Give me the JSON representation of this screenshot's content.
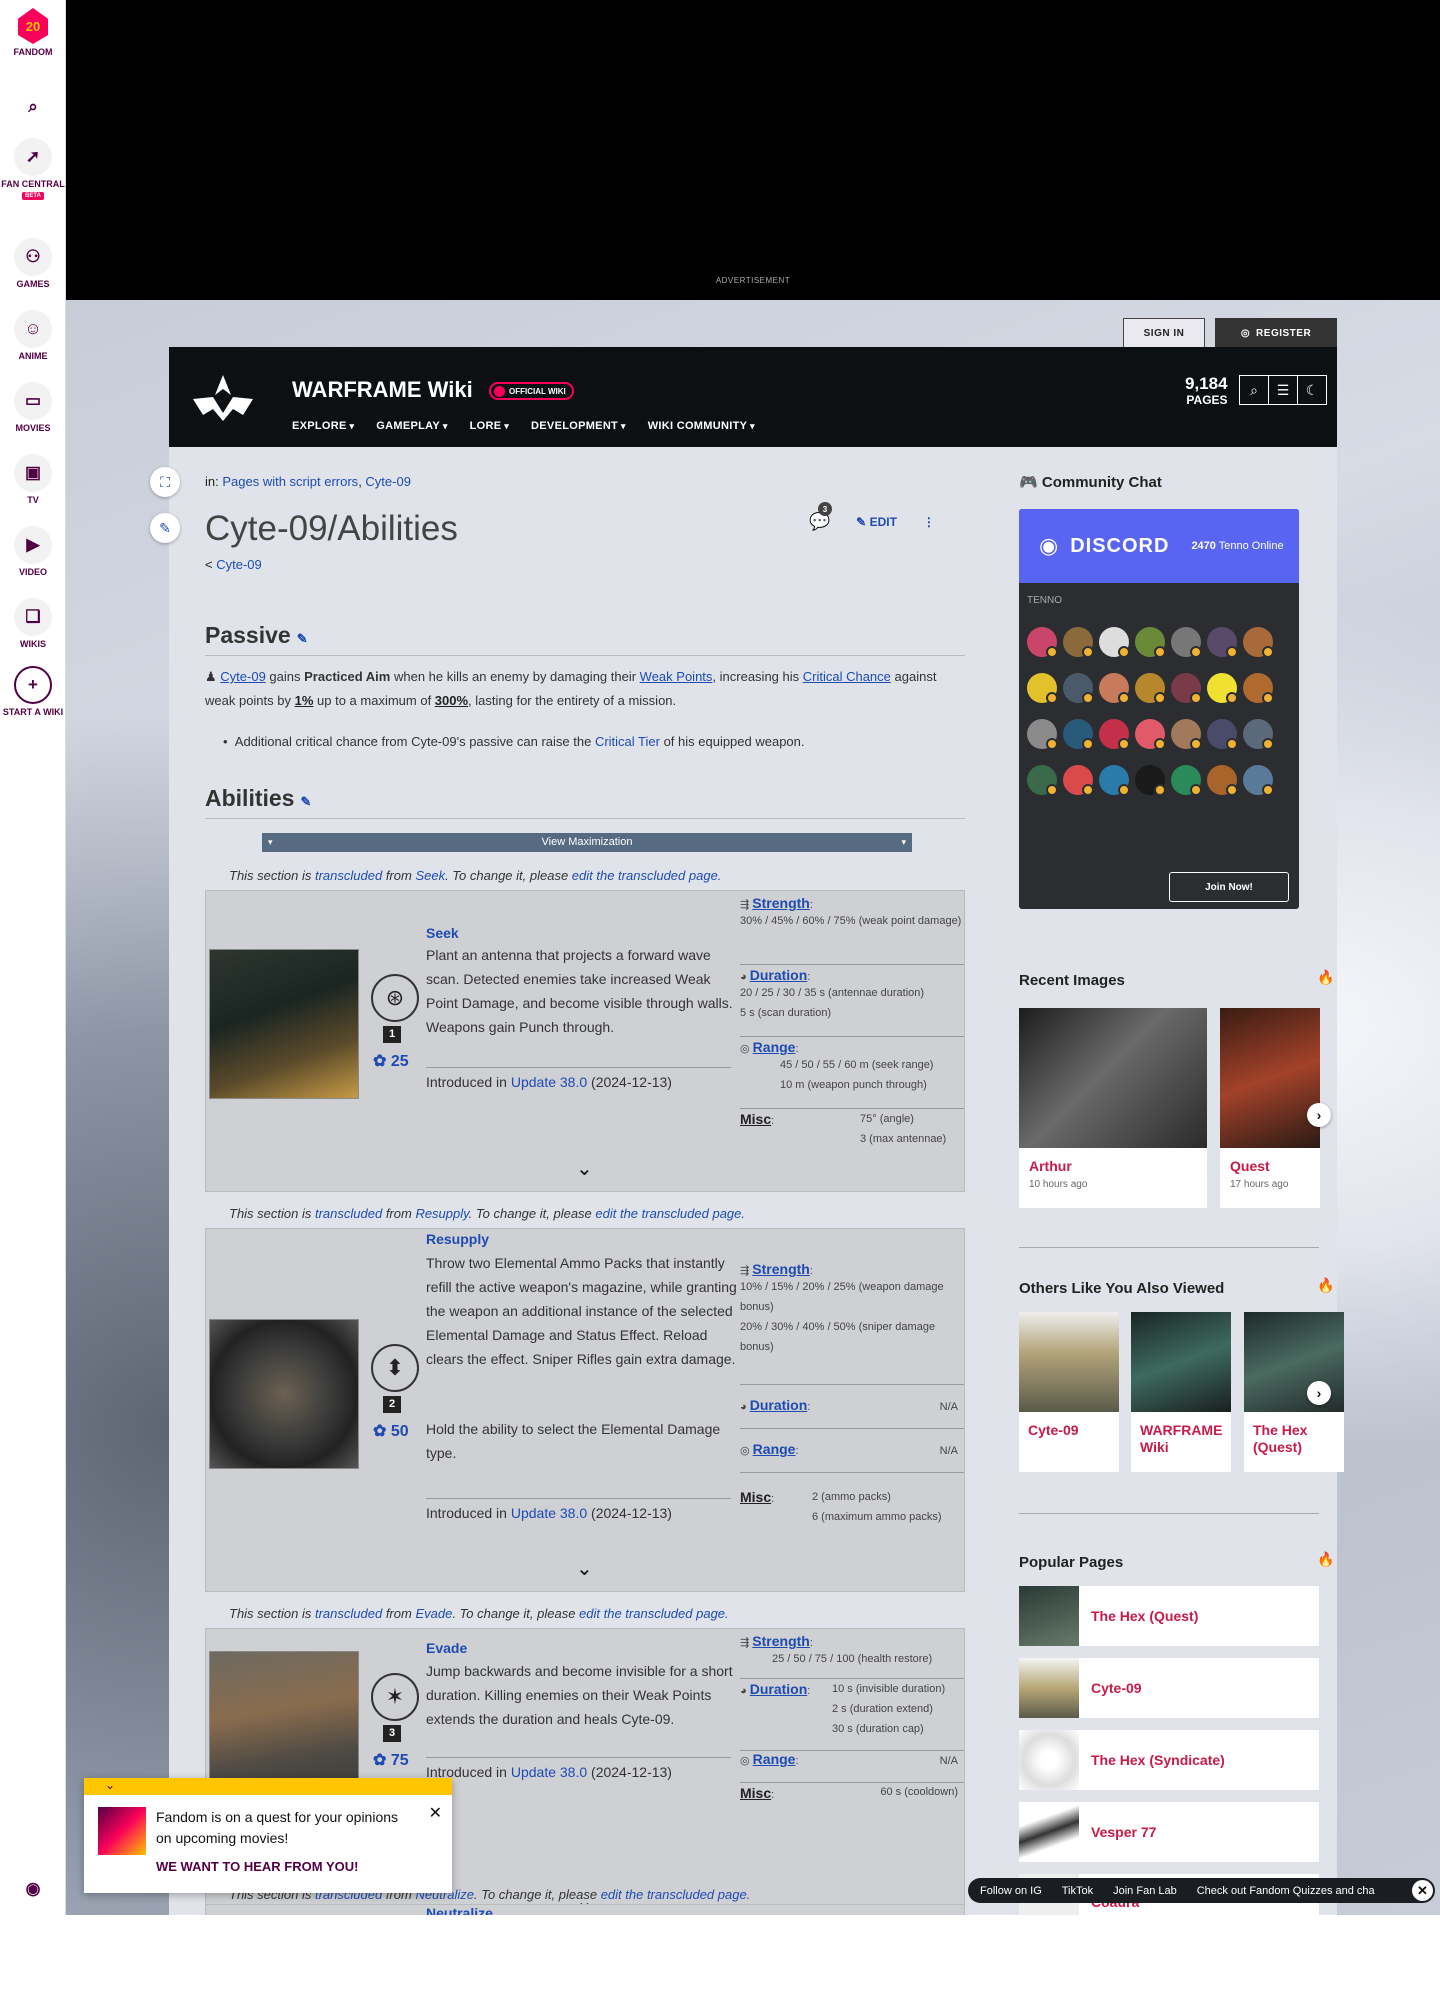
{
  "rail": {
    "fandom": "FANDOM",
    "fandom_badge": "20",
    "fan_central": "FAN CENTRAL",
    "beta": "BETA",
    "games": "GAMES",
    "anime": "ANIME",
    "movies": "MOVIES",
    "tv": "TV",
    "video": "VIDEO",
    "wikis": "WIKIS",
    "start_wiki": "START A WIKI"
  },
  "ad": {
    "label": "ADVERTISEMENT"
  },
  "auth": {
    "sign_in": "SIGN IN",
    "register": "REGISTER"
  },
  "header": {
    "title": "WARFRAME Wiki",
    "badge": "OFFICIAL WIKI",
    "pages_count": "9,184",
    "pages_label": "PAGES",
    "nav": [
      "EXPLORE",
      "GAMEPLAY",
      "LORE",
      "DEVELOPMENT",
      "WIKI COMMUNITY"
    ]
  },
  "page": {
    "in_label": "in:",
    "cat1": "Pages with script errors",
    "cat2": "Cyte-09",
    "title": "Cyte-09/Abilities",
    "parent": "Cyte-09",
    "comment_count": "3",
    "edit": "EDIT"
  },
  "passive": {
    "heading": "Passive",
    "p1": "Cyte-09",
    "p2": " gains ",
    "p3": "Practiced Aim",
    "p4": " when he kills an enemy by damaging their ",
    "p5": "Weak Points",
    "p6": ", increasing his ",
    "p7": "Critical Chance",
    "p8": " against weak points by ",
    "p9": "1%",
    "p10": " up to a maximum of ",
    "p11": "300%",
    "p12": ", lasting for the entirety of a mission.",
    "bullet_a": "Additional critical chance from Cyte-09's passive can raise the ",
    "bullet_b": "Critical Tier",
    "bullet_c": " of his equipped weapon."
  },
  "abilities_heading": "Abilities",
  "view_max": "View Maximization",
  "trans": {
    "a": "This section is ",
    "b": "transcluded",
    "c": " from ",
    "d": ". To change it, please ",
    "e": "edit the transcluded page."
  },
  "abilities": [
    {
      "name": "Seek",
      "num": "1",
      "cost": "25",
      "desc": "Plant an antenna that projects a forward wave scan. Detected enemies take increased Weak Point Damage, and become visible through walls. Weapons gain Punch through.",
      "desc2": "",
      "intro_a": "Introduced in ",
      "intro_b": "Update 38.0",
      "intro_c": " (2024-12-13)",
      "strength": "30% / 45% / 60% / 75% (weak point damage)",
      "duration": "20 / 25 / 30 / 35 s (antennae duration)",
      "duration2": "5 s (scan duration)",
      "range": "45 / 50 / 55 / 60 m (seek range)",
      "range2": "10 m (weapon punch through)",
      "misc": "75° (angle)",
      "misc2": "3 (max antennae)"
    },
    {
      "name": "Resupply",
      "num": "2",
      "cost": "50",
      "desc": "Throw two Elemental Ammo Packs that instantly refill the active weapon's magazine, while granting the weapon an additional instance of the selected Elemental Damage and Status Effect. Reload clears the effect. Sniper Rifles gain extra damage.",
      "desc2": "Hold the ability to select the Elemental Damage type.",
      "intro_a": "Introduced in ",
      "intro_b": "Update 38.0",
      "intro_c": " (2024-12-13)",
      "strength": "10% / 15% / 20% / 25% (weapon damage bonus)",
      "strength2": "20% / 30% / 40% / 50% (sniper damage bonus)",
      "duration": "N/A",
      "range": "N/A",
      "misc": "2 (ammo packs)",
      "misc2": "6 (maximum ammo packs)"
    },
    {
      "name": "Evade",
      "num": "3",
      "cost": "75",
      "desc": "Jump backwards and become invisible for a short duration. Killing enemies on their Weak Points extends the duration and heals Cyte-09.",
      "intro_a": "Introduced in ",
      "intro_b": "Update 38.0",
      "intro_c": " (2024-12-13)",
      "strength": "25 / 50 / 75 / 100 (health restore)",
      "duration": "10 s (invisible duration)",
      "duration2": "2 s (duration extend)",
      "duration3": "30 s (duration cap)",
      "range": "N/A",
      "misc": "60 s (cooldown)"
    },
    {
      "name": "Neutralize"
    }
  ],
  "stat_labels": {
    "strength": "Strength",
    "duration": "Duration",
    "range": "Range",
    "misc": "Misc"
  },
  "side": {
    "chat": "Community Chat",
    "discord": "DISCORD",
    "online_count": "2470",
    "online_label": "Tenno Online",
    "server": "TENNO",
    "join": "Join Now!",
    "recent_images": "Recent Images",
    "recent": [
      {
        "t": "Arthur",
        "d": "10 hours ago"
      },
      {
        "t": "Quest",
        "d": "17 hours ago"
      }
    ],
    "others": "Others Like You Also Viewed",
    "others_items": [
      "Cyte-09",
      "WARFRAME Wiki",
      "The Hex (Quest)"
    ],
    "popular": "Popular Pages",
    "popular_items": [
      "The Hex (Quest)",
      "Cyte-09",
      "The Hex (Syndicate)",
      "Vesper 77",
      "Coaura"
    ]
  },
  "survey": {
    "text": "Fandom is on a quest for your opinions on upcoming movies!",
    "cta": "WE WANT TO HEAR FROM YOU!"
  },
  "ticker": [
    "Follow on IG",
    "TikTok",
    "Join Fan Lab",
    "Check out Fandom Quizzes and cha"
  ],
  "colors": {
    "brand": "#fa005a",
    "link": "#1e4bb3",
    "discord": "#5865f2"
  }
}
